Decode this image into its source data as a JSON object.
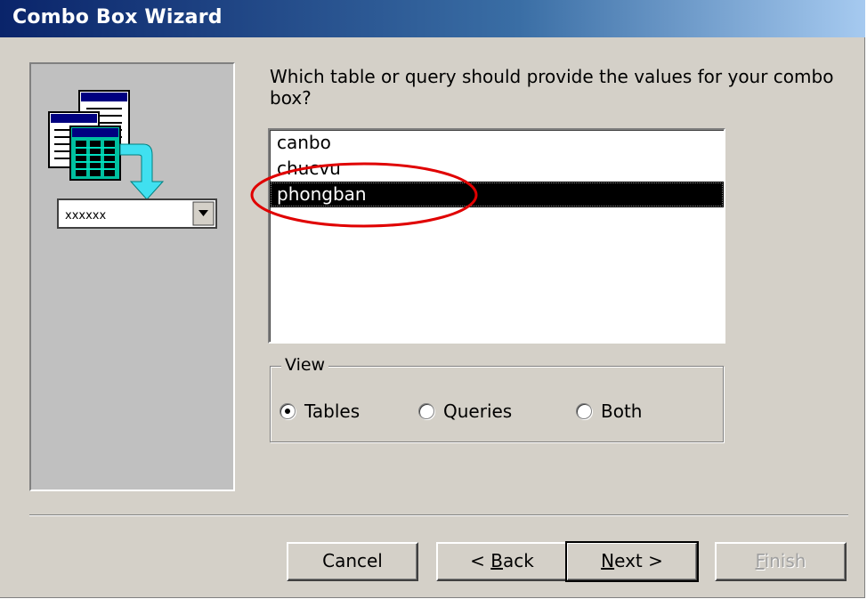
{
  "window": {
    "title": "Combo Box Wizard"
  },
  "left_panel": {
    "combo_sample_text": "xxxxxx"
  },
  "prompt": "Which table or query should provide the values for your combo box?",
  "list": {
    "items": [
      {
        "label": "canbo",
        "selected": false
      },
      {
        "label": "chucvu",
        "selected": false
      },
      {
        "label": "phongban",
        "selected": true
      }
    ]
  },
  "view": {
    "label": "View",
    "options": [
      {
        "label": "Tables",
        "checked": true
      },
      {
        "label": "Queries",
        "checked": false
      },
      {
        "label": "Both",
        "checked": false
      }
    ]
  },
  "buttons": {
    "cancel": "Cancel",
    "back_prefix": "< ",
    "back_key": "B",
    "back_rest": "ack",
    "next_key": "N",
    "next_rest": "ext >",
    "finish_key": "F",
    "finish_rest": "inish"
  },
  "colors": {
    "title_start": "#0a246a",
    "title_end": "#a6caf0",
    "face": "#d4d0c8",
    "highlight_ring": "#e00000"
  }
}
